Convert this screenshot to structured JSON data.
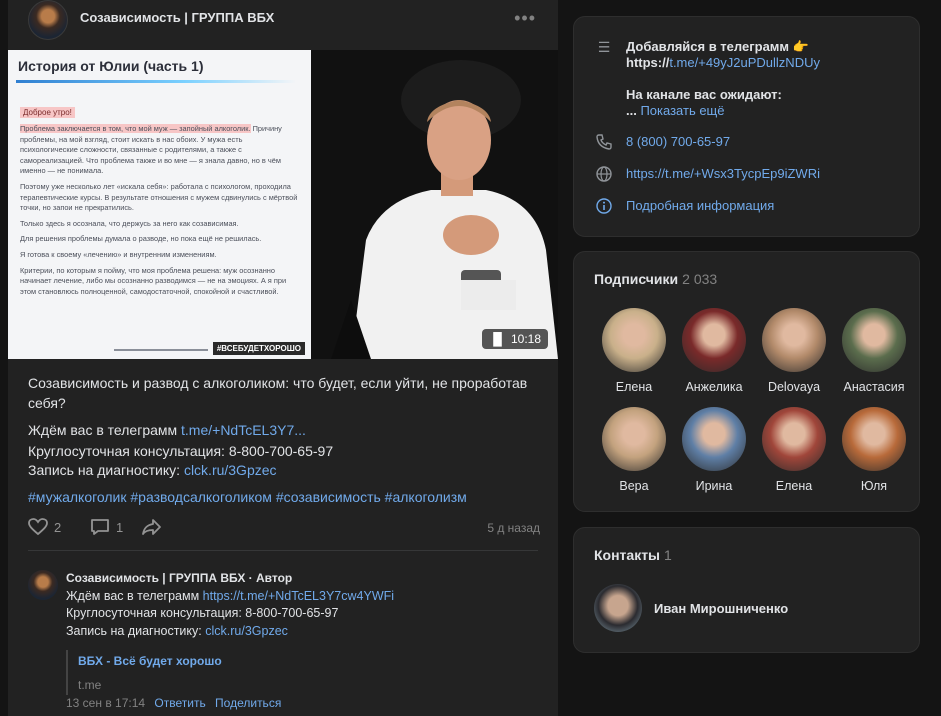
{
  "post": {
    "group_name": "Созависимость | ГРУППА ВБХ",
    "video": {
      "slide_title": "История от Юлии (часть 1)",
      "slide_greeting": "Доброе утро!",
      "slide_p1_hl": "Проблема заключается в том, что мой муж — запойный алкоголик.",
      "slide_p1_rest": " Причину проблемы, на мой взгляд, стоит искать в нас обоих. У мужа есть психологические сложности, связанные с родителями, а также с самореализацией. Что проблема также и во мне — я знала давно, но в чём именно — не понимала.",
      "slide_p2": "Поэтому уже несколько лет «искала себя»: работала с психологом, проходила терапевтические курсы. В результате отношения с мужем сдвинулись с мёртвой точки, но запои не прекратились.",
      "slide_p3": "Только здесь я осознала, что держусь за него как созависимая.",
      "slide_p4": "Для решения проблемы думала о разводе, но пока ещё не решилась.",
      "slide_p5": "Я готова к своему «лечению» и внутренним изменениям.",
      "slide_p6": "Критерии, по которым я пойму, что моя проблема решена: муж осознанно начинает лечение, либо мы осознанно разводимся — не на эмоциях. А я при этом становлюсь полноценной, самодостаточной, спокойной и счастливой.",
      "slide_tag": "#ВСЕБУДЕТХОРОШО",
      "duration": "10:18"
    },
    "title": "Созависимость и развод с алкоголиком: что будет, если уйти, не проработав себя?",
    "line1_prefix": "Ждём вас в телеграмм ",
    "line1_link": "t.me/+NdTcEL3Y7...",
    "line2": "Круглосуточная консультация: 8-800-700-65-97",
    "line3_prefix": "Запись на диагностику: ",
    "line3_link": "clck.ru/3Gpzec",
    "hashtags": "#мужалкоголик #разводсалкоголиком #созависимость #алкоголизм",
    "likes": "2",
    "comments": "1",
    "time_ago": "5 д назад"
  },
  "comment": {
    "author": "Созависимость | ГРУППА ВБХ · Автор",
    "line1_prefix": "Ждём вас в телеграмм ",
    "line1_link": "https://t.me/+NdTcEL3Y7cw4YWFi",
    "line2": "Круглосуточная консультация: 8-800-700-65-97",
    "line3_prefix": "Запись на диагностику: ",
    "line3_link": "clck.ru/3Gpzec",
    "quote_title": "ВБХ - Всё будет хорошо",
    "quote_src": "t.me",
    "date": "13 сен в 17:14",
    "reply": "Ответить",
    "share": "Поделиться"
  },
  "info": {
    "desc_line1": "Добавляйся в телеграмм 👉",
    "desc_line2_prefix": "https://",
    "desc_line2_link": "t.me/+49yJ2uPDullzNDUy",
    "desc_line3": "На канале вас ожидают:",
    "desc_line4_prefix": "... ",
    "show_more": "Показать ещё",
    "phone": "8 (800) 700-65-97",
    "site": "https://t.me/+Wsx3TycpEp9iZWRi",
    "details": "Подробная информация"
  },
  "subscribers": {
    "title": "Подписчики",
    "count": "2 033",
    "items": [
      {
        "name": "Елена",
        "color": "#c9b08a"
      },
      {
        "name": "Анжелика",
        "color": "#7a2a2a"
      },
      {
        "name": "Delovaya",
        "color": "#b28a6a"
      },
      {
        "name": "Анастасия",
        "color": "#5b6d4d"
      },
      {
        "name": "Вера",
        "color": "#c3a27e"
      },
      {
        "name": "Ирина",
        "color": "#5f7fa6"
      },
      {
        "name": "Елена",
        "color": "#a0463a"
      },
      {
        "name": "Юля",
        "color": "#b86a3a"
      }
    ]
  },
  "contacts": {
    "title": "Контакты",
    "count": "1",
    "name": "Иван Мирошниченко"
  }
}
